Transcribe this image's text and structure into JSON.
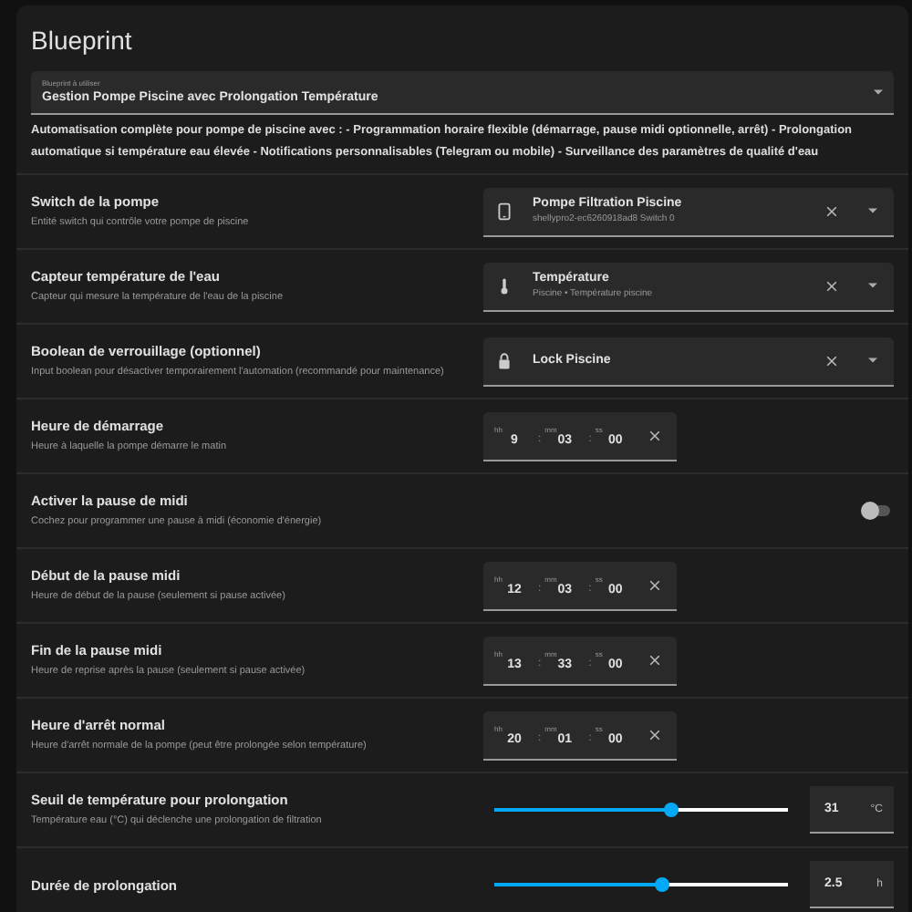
{
  "title": "Blueprint",
  "blueprint_select": {
    "label": "Blueprint à utiliser",
    "value": "Gestion Pompe Piscine avec Prolongation Température"
  },
  "description": "Automatisation complète pour pompe de piscine avec : - Programmation horaire flexible (démarrage, pause midi optionnelle, arrêt) - Prolongation automatique si température eau élevée - Notifications personnalisables (Telegram ou mobile) - Surveillance des paramètres de qualité d'eau",
  "inputs": [
    {
      "kind": "entity",
      "label": "Switch de la pompe",
      "help": "Entité switch qui contrôle votre pompe de piscine",
      "name": "Pompe Filtration Piscine",
      "secondary": "shellypro2-ec6260918ad8 Switch 0"
    },
    {
      "kind": "entity",
      "label": "Capteur température de l'eau",
      "help": "Capteur qui mesure la température de l'eau de la piscine",
      "name": "Température",
      "secondary": "Piscine • Température piscine"
    },
    {
      "kind": "entity",
      "label": "Boolean de verrouillage (optionnel)",
      "help": "Input boolean pour désactiver temporairement l'automation (recommandé pour maintenance)",
      "name": "Lock Piscine"
    },
    {
      "kind": "time",
      "label": "Heure de démarrage",
      "help": "Heure à laquelle la pompe démarre le matin",
      "units": [
        "hh",
        "mm",
        "ss"
      ],
      "values": [
        "9",
        "03",
        "00"
      ],
      "separators": [
        ":",
        ":"
      ]
    },
    {
      "kind": "toggle",
      "label": "Activer la pause de midi",
      "help": "Cochez pour programmer une pause à midi (économie d'énergie)",
      "on": false
    },
    {
      "kind": "time",
      "label": "Début de la pause midi",
      "help": "Heure de début de la pause (seulement si pause activée)",
      "units": [
        "hh",
        "mm",
        "ss"
      ],
      "values": [
        "12",
        "03",
        "00"
      ],
      "separators": [
        ":",
        ":"
      ]
    },
    {
      "kind": "time",
      "label": "Fin de la pause midi",
      "help": "Heure de reprise après la pause (seulement si pause activée)",
      "units": [
        "hh",
        "mm",
        "ss"
      ],
      "values": [
        "13",
        "33",
        "00"
      ],
      "separators": [
        ":",
        ":"
      ]
    },
    {
      "kind": "time",
      "label": "Heure d'arrêt normal",
      "help": "Heure d'arrêt normale de la pompe (peut être prolongée selon température)",
      "units": [
        "hh",
        "mm",
        "ss"
      ],
      "values": [
        "20",
        "01",
        "00"
      ],
      "separators": [
        ":",
        ":"
      ]
    },
    {
      "kind": "slider",
      "label": "Seuil de température pour prolongation",
      "help": "Température eau (°C) qui déclenche une prolongation de filtration",
      "level": 0.6,
      "value": "31",
      "unit": "°C"
    },
    {
      "kind": "slider",
      "label": "Durée de prolongation",
      "level": 0.57,
      "value": "2.5",
      "unit": "h"
    }
  ]
}
